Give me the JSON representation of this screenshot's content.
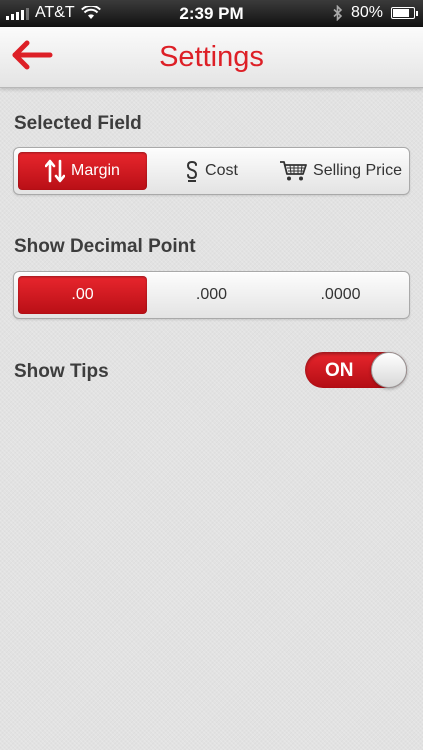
{
  "status_bar": {
    "carrier": "AT&T",
    "time": "2:39 PM",
    "battery": "80%",
    "battery_level": 0.8,
    "icons": [
      "signal-icon",
      "wifi-icon",
      "bluetooth-icon",
      "battery-icon"
    ]
  },
  "nav": {
    "title": "Settings",
    "back_icon": "back-arrow-icon"
  },
  "selected_field": {
    "label": "Selected Field",
    "options": [
      {
        "label": "Margin",
        "icon": "up-down-arrows-icon",
        "selected": true
      },
      {
        "label": "Cost",
        "icon": "dollar-icon",
        "selected": false
      },
      {
        "label": "Selling Price",
        "icon": "cart-icon",
        "selected": false
      }
    ]
  },
  "decimal_point": {
    "label": "Show Decimal Point",
    "options": [
      {
        "label": ".00",
        "selected": true
      },
      {
        "label": ".000",
        "selected": false
      },
      {
        "label": ".0000",
        "selected": false
      }
    ]
  },
  "tips": {
    "label": "Show Tips",
    "state": "ON"
  },
  "colors": {
    "accent": "#dd1f26",
    "label_text": "#3d3d3d"
  }
}
